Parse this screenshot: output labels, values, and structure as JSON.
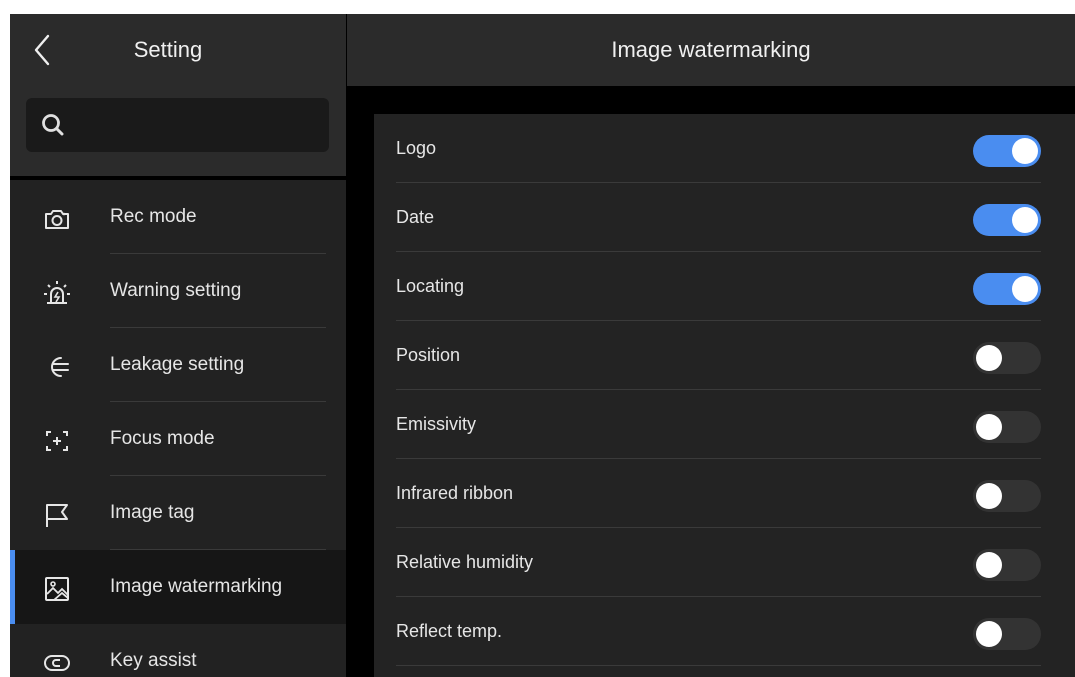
{
  "sidebar": {
    "title": "Setting",
    "search": {
      "value": "",
      "placeholder": ""
    },
    "items": [
      {
        "label": "Rec mode",
        "icon": "camera-icon",
        "active": false
      },
      {
        "label": "Warning setting",
        "icon": "alarm-icon",
        "active": false
      },
      {
        "label": "Leakage setting",
        "icon": "leakage-icon",
        "active": false
      },
      {
        "label": "Focus mode",
        "icon": "focus-icon",
        "active": false
      },
      {
        "label": "Image tag",
        "icon": "flag-icon",
        "active": false
      },
      {
        "label": "Image watermarking",
        "icon": "image-icon",
        "active": true
      },
      {
        "label": "Key assist",
        "icon": "key-icon",
        "active": false
      }
    ]
  },
  "main": {
    "title": "Image watermarking",
    "options": [
      {
        "label": "Logo",
        "enabled": true
      },
      {
        "label": "Date",
        "enabled": true
      },
      {
        "label": "Locating",
        "enabled": true
      },
      {
        "label": "Position",
        "enabled": false
      },
      {
        "label": "Emissivity",
        "enabled": false
      },
      {
        "label": "Infrared ribbon",
        "enabled": false
      },
      {
        "label": "Relative humidity",
        "enabled": false
      },
      {
        "label": "Reflect temp.",
        "enabled": false
      }
    ]
  },
  "colors": {
    "accent": "#4a8df0",
    "toggle_off": "#333333",
    "panel": "#232323",
    "header": "#2b2b2b"
  }
}
